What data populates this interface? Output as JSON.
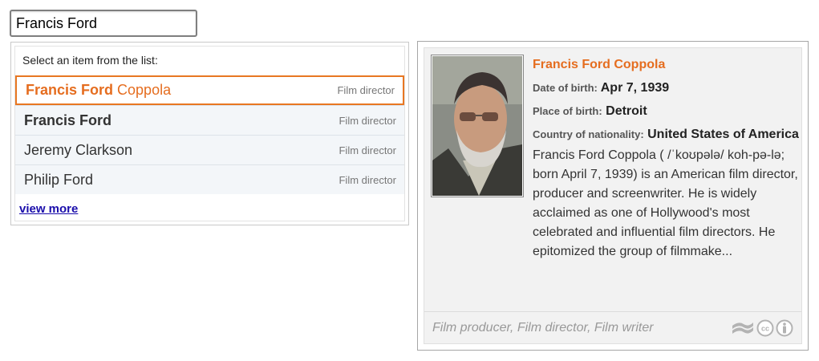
{
  "search": {
    "value": "Francis Ford"
  },
  "dropdown": {
    "header": "Select an item from the list:",
    "items": [
      {
        "match": "Francis Ford",
        "rest": " Coppola",
        "type": "Film director",
        "selected": true
      },
      {
        "match": "Francis Ford",
        "rest": "",
        "type": "Film director",
        "selected": false
      },
      {
        "match": "",
        "rest": "Jeremy Clarkson",
        "type": "Film director",
        "selected": false
      },
      {
        "match": "",
        "rest": "Philip Ford",
        "type": "Film director",
        "selected": false
      }
    ],
    "view_more": "view more"
  },
  "flyout": {
    "name": "Francis Ford Coppola",
    "dob_label": "Date of birth:",
    "dob_value": "Apr 7, 1939",
    "pob_label": "Place of birth:",
    "pob_value": "Detroit",
    "nationality_label": "Country of nationality:",
    "nationality_value": "United States of America",
    "description": "Francis Ford Coppola ( /ˈkoʊpələ/ koh-pə-lə; born April 7, 1939) is an American film director, producer and screenwriter. He is widely acclaimed as one of Hollywood's most celebrated and influential film directors. He epitomized the group of filmmake...",
    "notable_types": "Film producer, Film director, Film writer",
    "icons": [
      "freebase-logo-icon",
      "creative-commons-icon",
      "attribution-icon"
    ]
  },
  "colors": {
    "accent": "#e56d1f",
    "link": "#1a0dab",
    "selected_border": "#e87722"
  }
}
